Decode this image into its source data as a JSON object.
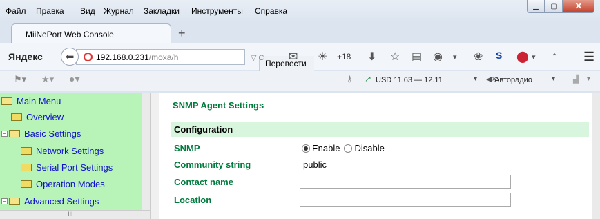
{
  "menubar": {
    "items": [
      "Файл",
      "Правка",
      "Вид",
      "Журнал",
      "Закладки",
      "Инструменты",
      "Справка"
    ]
  },
  "tab": {
    "title": "MiiNePort Web Console",
    "new_tab": "+"
  },
  "nav": {
    "brand": "Яндекс",
    "url_host": "192.168.0.231",
    "url_path": "/moxa/h",
    "translate": "Перевести",
    "weather": "+18"
  },
  "bookmarks": {
    "currency": "USD 11.63 — 12.11",
    "radio": "Авторадио"
  },
  "sidebar": {
    "items": [
      {
        "label": "Main Menu"
      },
      {
        "label": "Overview"
      },
      {
        "label": "Basic Settings"
      },
      {
        "label": "Network Settings"
      },
      {
        "label": "Serial Port Settings"
      },
      {
        "label": "Operation Modes"
      },
      {
        "label": "Advanced Settings"
      }
    ],
    "hscroll_mark": "III"
  },
  "page": {
    "title": "SNMP Agent Settings",
    "section": "Configuration",
    "fields": {
      "snmp_label": "SNMP",
      "enable_label": "Enable",
      "disable_label": "Disable",
      "community_label": "Community string",
      "community_value": "public",
      "contact_label": "Contact name",
      "contact_value": "",
      "location_label": "Location",
      "location_value": ""
    }
  }
}
